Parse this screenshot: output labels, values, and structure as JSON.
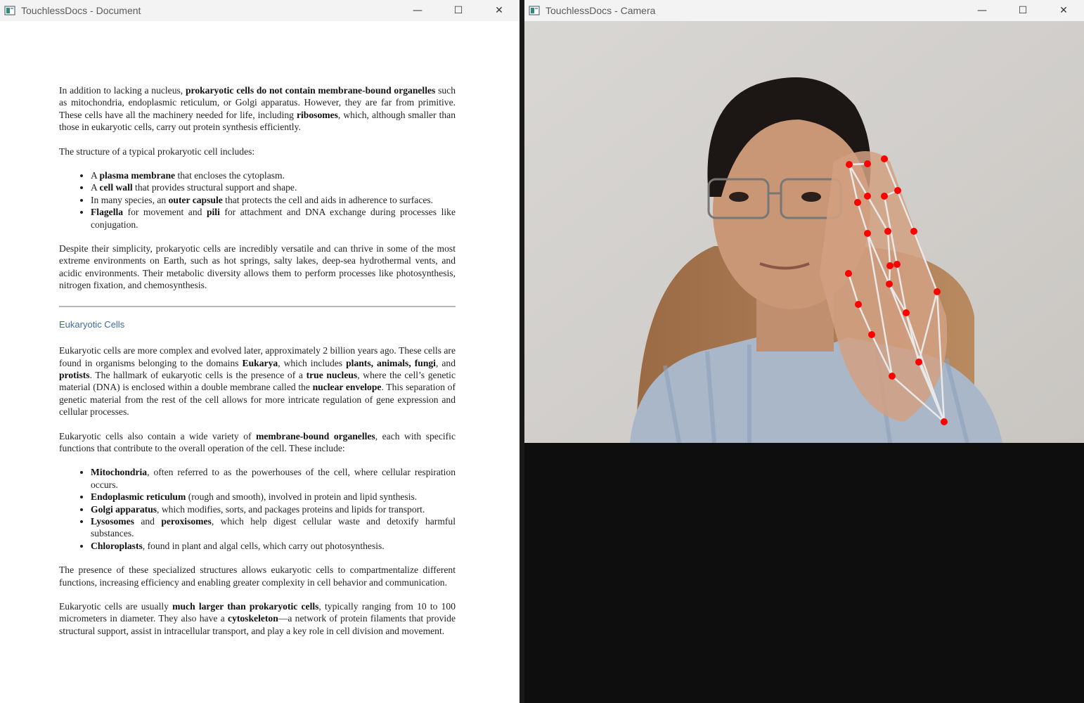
{
  "document_window": {
    "title": "TouchlessDocs - Document",
    "controls": {
      "minimize": "—",
      "maximize": "☐",
      "close": "✕"
    },
    "body": {
      "p1_parts": [
        {
          "t": "In addition to lacking a nucleus, ",
          "b": false
        },
        {
          "t": "prokaryotic cells do not contain membrane-bound organelles",
          "b": true
        },
        {
          "t": " such as mitochondria, endoplasmic reticulum, or Golgi apparatus. However, they are far from primitive. These cells have all the machinery needed for life, including ",
          "b": false
        },
        {
          "t": "ribosomes",
          "b": true
        },
        {
          "t": ", which, although smaller than those in eukaryotic cells, carry out protein synthesis efficiently.",
          "b": false
        }
      ],
      "p2": "The structure of a typical prokaryotic cell includes:",
      "list1": [
        [
          {
            "t": "A ",
            "b": false
          },
          {
            "t": "plasma membrane",
            "b": true
          },
          {
            "t": " that encloses the cytoplasm.",
            "b": false
          }
        ],
        [
          {
            "t": "A ",
            "b": false
          },
          {
            "t": "cell wall",
            "b": true
          },
          {
            "t": " that provides structural support and shape.",
            "b": false
          }
        ],
        [
          {
            "t": "In many species, an ",
            "b": false
          },
          {
            "t": "outer capsule",
            "b": true
          },
          {
            "t": " that protects the cell and aids in adherence to surfaces.",
            "b": false
          }
        ],
        [
          {
            "t": "Flagella",
            "b": true
          },
          {
            "t": " for movement and ",
            "b": false
          },
          {
            "t": "pili",
            "b": true
          },
          {
            "t": " for attachment and DNA exchange during processes like conjugation.",
            "b": false
          }
        ]
      ],
      "p3": "Despite their simplicity, prokaryotic cells are incredibly versatile and can thrive in some of the most extreme environments on Earth, such as hot springs, salty lakes, deep-sea hydrothermal vents, and acidic environments. Their metabolic diversity allows them to perform processes like photosynthesis, nitrogen fixation, and chemosynthesis.",
      "heading": "Eukaryotic Cells",
      "p4_parts": [
        {
          "t": "Eukaryotic cells are more complex and evolved later, approximately 2 billion years ago. These cells are found in organisms belonging to the domains ",
          "b": false
        },
        {
          "t": "Eukarya",
          "b": true
        },
        {
          "t": ", which includes ",
          "b": false
        },
        {
          "t": "plants, animals, fungi",
          "b": true
        },
        {
          "t": ", and ",
          "b": false
        },
        {
          "t": "protists",
          "b": true
        },
        {
          "t": ". The hallmark of eukaryotic cells is the presence of a ",
          "b": false
        },
        {
          "t": "true nucleus",
          "b": true
        },
        {
          "t": ", where the cell’s genetic material (DNA) is enclosed within a double membrane called the ",
          "b": false
        },
        {
          "t": "nuclear envelope",
          "b": true
        },
        {
          "t": ". This separation of genetic material from the rest of the cell allows for more intricate regulation of gene expression and cellular processes.",
          "b": false
        }
      ],
      "p5_parts": [
        {
          "t": "Eukaryotic cells also contain a wide variety of ",
          "b": false
        },
        {
          "t": "membrane-bound organelles",
          "b": true
        },
        {
          "t": ", each with specific functions that contribute to the overall operation of the cell. These include:",
          "b": false
        }
      ],
      "list2": [
        [
          {
            "t": "Mitochondria",
            "b": true
          },
          {
            "t": ", often referred to as the powerhouses of the cell, where cellular respiration occurs.",
            "b": false
          }
        ],
        [
          {
            "t": "Endoplasmic reticulum",
            "b": true
          },
          {
            "t": " (rough and smooth), involved in protein and lipid synthesis.",
            "b": false
          }
        ],
        [
          {
            "t": "Golgi apparatus",
            "b": true
          },
          {
            "t": ", which modifies, sorts, and packages proteins and lipids for transport.",
            "b": false
          }
        ],
        [
          {
            "t": "Lysosomes",
            "b": true
          },
          {
            "t": " and ",
            "b": false
          },
          {
            "t": "peroxisomes",
            "b": true
          },
          {
            "t": ", which help digest cellular waste and detoxify harmful substances.",
            "b": false
          }
        ],
        [
          {
            "t": "Chloroplasts",
            "b": true
          },
          {
            "t": ", found in plant and algal cells, which carry out photosynthesis.",
            "b": false
          }
        ]
      ],
      "p6": "The presence of these specialized structures allows eukaryotic cells to compartmentalize different functions, increasing efficiency and enabling greater complexity in cell behavior and communication.",
      "p7_parts": [
        {
          "t": "Eukaryotic cells are usually ",
          "b": false
        },
        {
          "t": "much larger than prokaryotic cells",
          "b": true
        },
        {
          "t": ", typically ranging from 10 to 100 micrometers in diameter. They also have a ",
          "b": false
        },
        {
          "t": "cytoskeleton",
          "b": true
        },
        {
          "t": "—a network of protein filaments that provide structural support, assist in intracellular transport, and play a key role in cell division and movement.",
          "b": false
        }
      ]
    }
  },
  "camera_window": {
    "title": "TouchlessDocs - Camera",
    "controls": {
      "minimize": "—",
      "maximize": "☐",
      "close": "✕"
    },
    "landmark_color": "#ff0000",
    "connector_color": "#e8e8e8"
  }
}
